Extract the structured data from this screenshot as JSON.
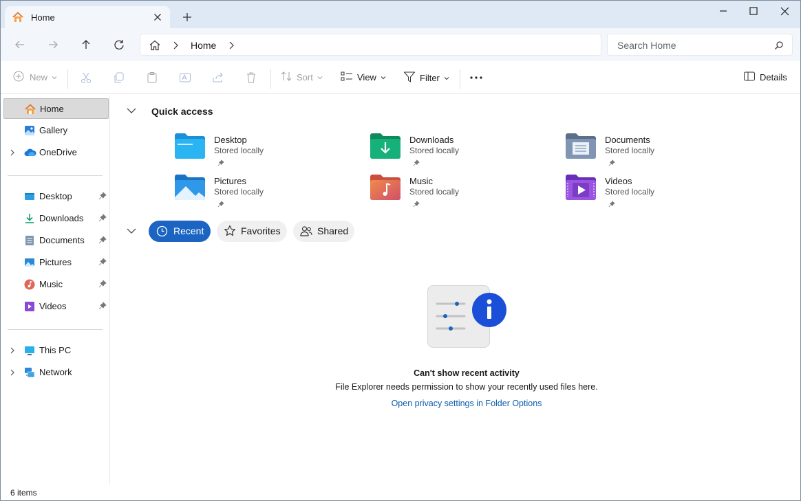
{
  "tab": {
    "title": "Home"
  },
  "window": {
    "minimize": "minimize-icon",
    "maximize": "maximize-icon",
    "close": "close-icon"
  },
  "address": {
    "crumb": "Home"
  },
  "search": {
    "placeholder": "Search Home"
  },
  "toolbar": {
    "new": "New",
    "sort": "Sort",
    "view": "View",
    "filter": "Filter",
    "details": "Details"
  },
  "sidebar": {
    "top": [
      {
        "label": "Home",
        "icon": "home-icon"
      },
      {
        "label": "Gallery",
        "icon": "gallery-icon"
      },
      {
        "label": "OneDrive",
        "icon": "onedrive-icon"
      }
    ],
    "pinned": [
      {
        "label": "Desktop",
        "icon": "desktop-icon"
      },
      {
        "label": "Downloads",
        "icon": "downloads-icon"
      },
      {
        "label": "Documents",
        "icon": "documents-icon"
      },
      {
        "label": "Pictures",
        "icon": "pictures-icon"
      },
      {
        "label": "Music",
        "icon": "music-icon"
      },
      {
        "label": "Videos",
        "icon": "videos-icon"
      }
    ],
    "bottom": [
      {
        "label": "This PC",
        "icon": "this-pc-icon"
      },
      {
        "label": "Network",
        "icon": "network-icon"
      }
    ]
  },
  "quick_access": {
    "title": "Quick access",
    "items": [
      {
        "name": "Desktop",
        "sub": "Stored locally"
      },
      {
        "name": "Downloads",
        "sub": "Stored locally"
      },
      {
        "name": "Documents",
        "sub": "Stored locally"
      },
      {
        "name": "Pictures",
        "sub": "Stored locally"
      },
      {
        "name": "Music",
        "sub": "Stored locally"
      },
      {
        "name": "Videos",
        "sub": "Stored locally"
      }
    ]
  },
  "pills": {
    "recent": "Recent",
    "favorites": "Favorites",
    "shared": "Shared"
  },
  "empty": {
    "title": "Can't show recent activity",
    "desc": "File Explorer needs permission to show your recently used files here.",
    "link": "Open privacy settings in Folder Options"
  },
  "status": {
    "items": "6 items"
  },
  "colors": {
    "accent": "#1b64c2",
    "link": "#0b5cad"
  }
}
